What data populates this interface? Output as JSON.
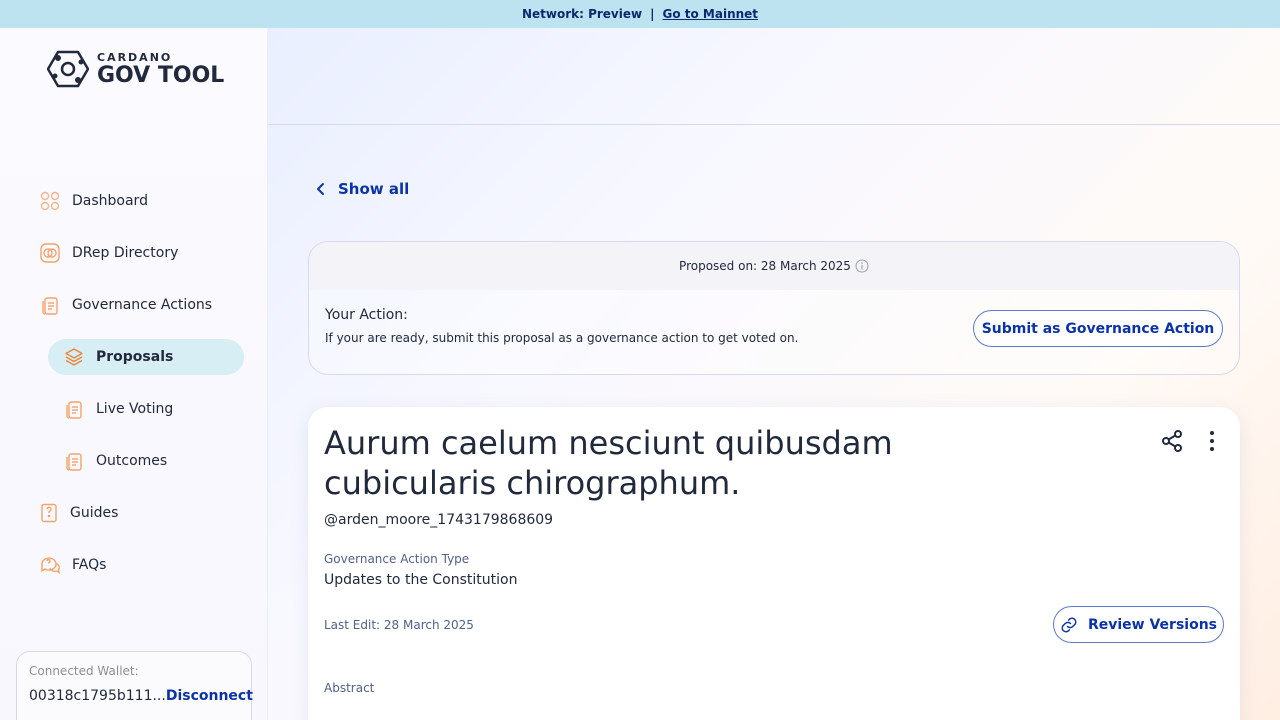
{
  "banner": {
    "network_text": "Network: Preview",
    "separator": "|",
    "mainnet_link": "Go to Mainnet"
  },
  "logo": {
    "small": "CARDANO",
    "big": "GOV TOOL"
  },
  "sidebar": {
    "items": [
      {
        "label": "Dashboard",
        "icon": "dashboard-icon"
      },
      {
        "label": "DRep Directory",
        "icon": "drep-directory-icon"
      },
      {
        "label": "Governance Actions",
        "icon": "governance-actions-icon"
      },
      {
        "label": "Proposals",
        "icon": "proposals-icon",
        "active": true
      },
      {
        "label": "Live Voting",
        "icon": "live-voting-icon"
      },
      {
        "label": "Outcomes",
        "icon": "outcomes-icon"
      },
      {
        "label": "Guides",
        "icon": "guides-icon"
      },
      {
        "label": "FAQs",
        "icon": "faqs-icon"
      }
    ]
  },
  "wallet": {
    "label": "Connected Wallet:",
    "address": "00318c1795b111...",
    "disconnect": "Disconnect"
  },
  "main": {
    "show_all": "Show all",
    "proposed_on": "Proposed on: 28 March 2025",
    "your_action_title": "Your Action:",
    "your_action_desc": "If your are ready, submit this proposal as a governance action to get voted on.",
    "submit_button": "Submit as Governance Action",
    "proposal": {
      "title": "Aurum caelum nesciunt quibusdam cubicularis chirographum.",
      "author": "@arden_moore_1743179868609",
      "type_label": "Governance Action Type",
      "type_value": "Updates to the Constitution",
      "last_edit": "Last Edit: 28 March 2025",
      "review_button": "Review Versions",
      "abstract_label": "Abstract"
    }
  },
  "colors": {
    "accent": "#0b33a6",
    "banner_bg": "#bde3f0",
    "active_nav_bg": "#d6eef4",
    "icon_orange": "#f6a36b"
  }
}
